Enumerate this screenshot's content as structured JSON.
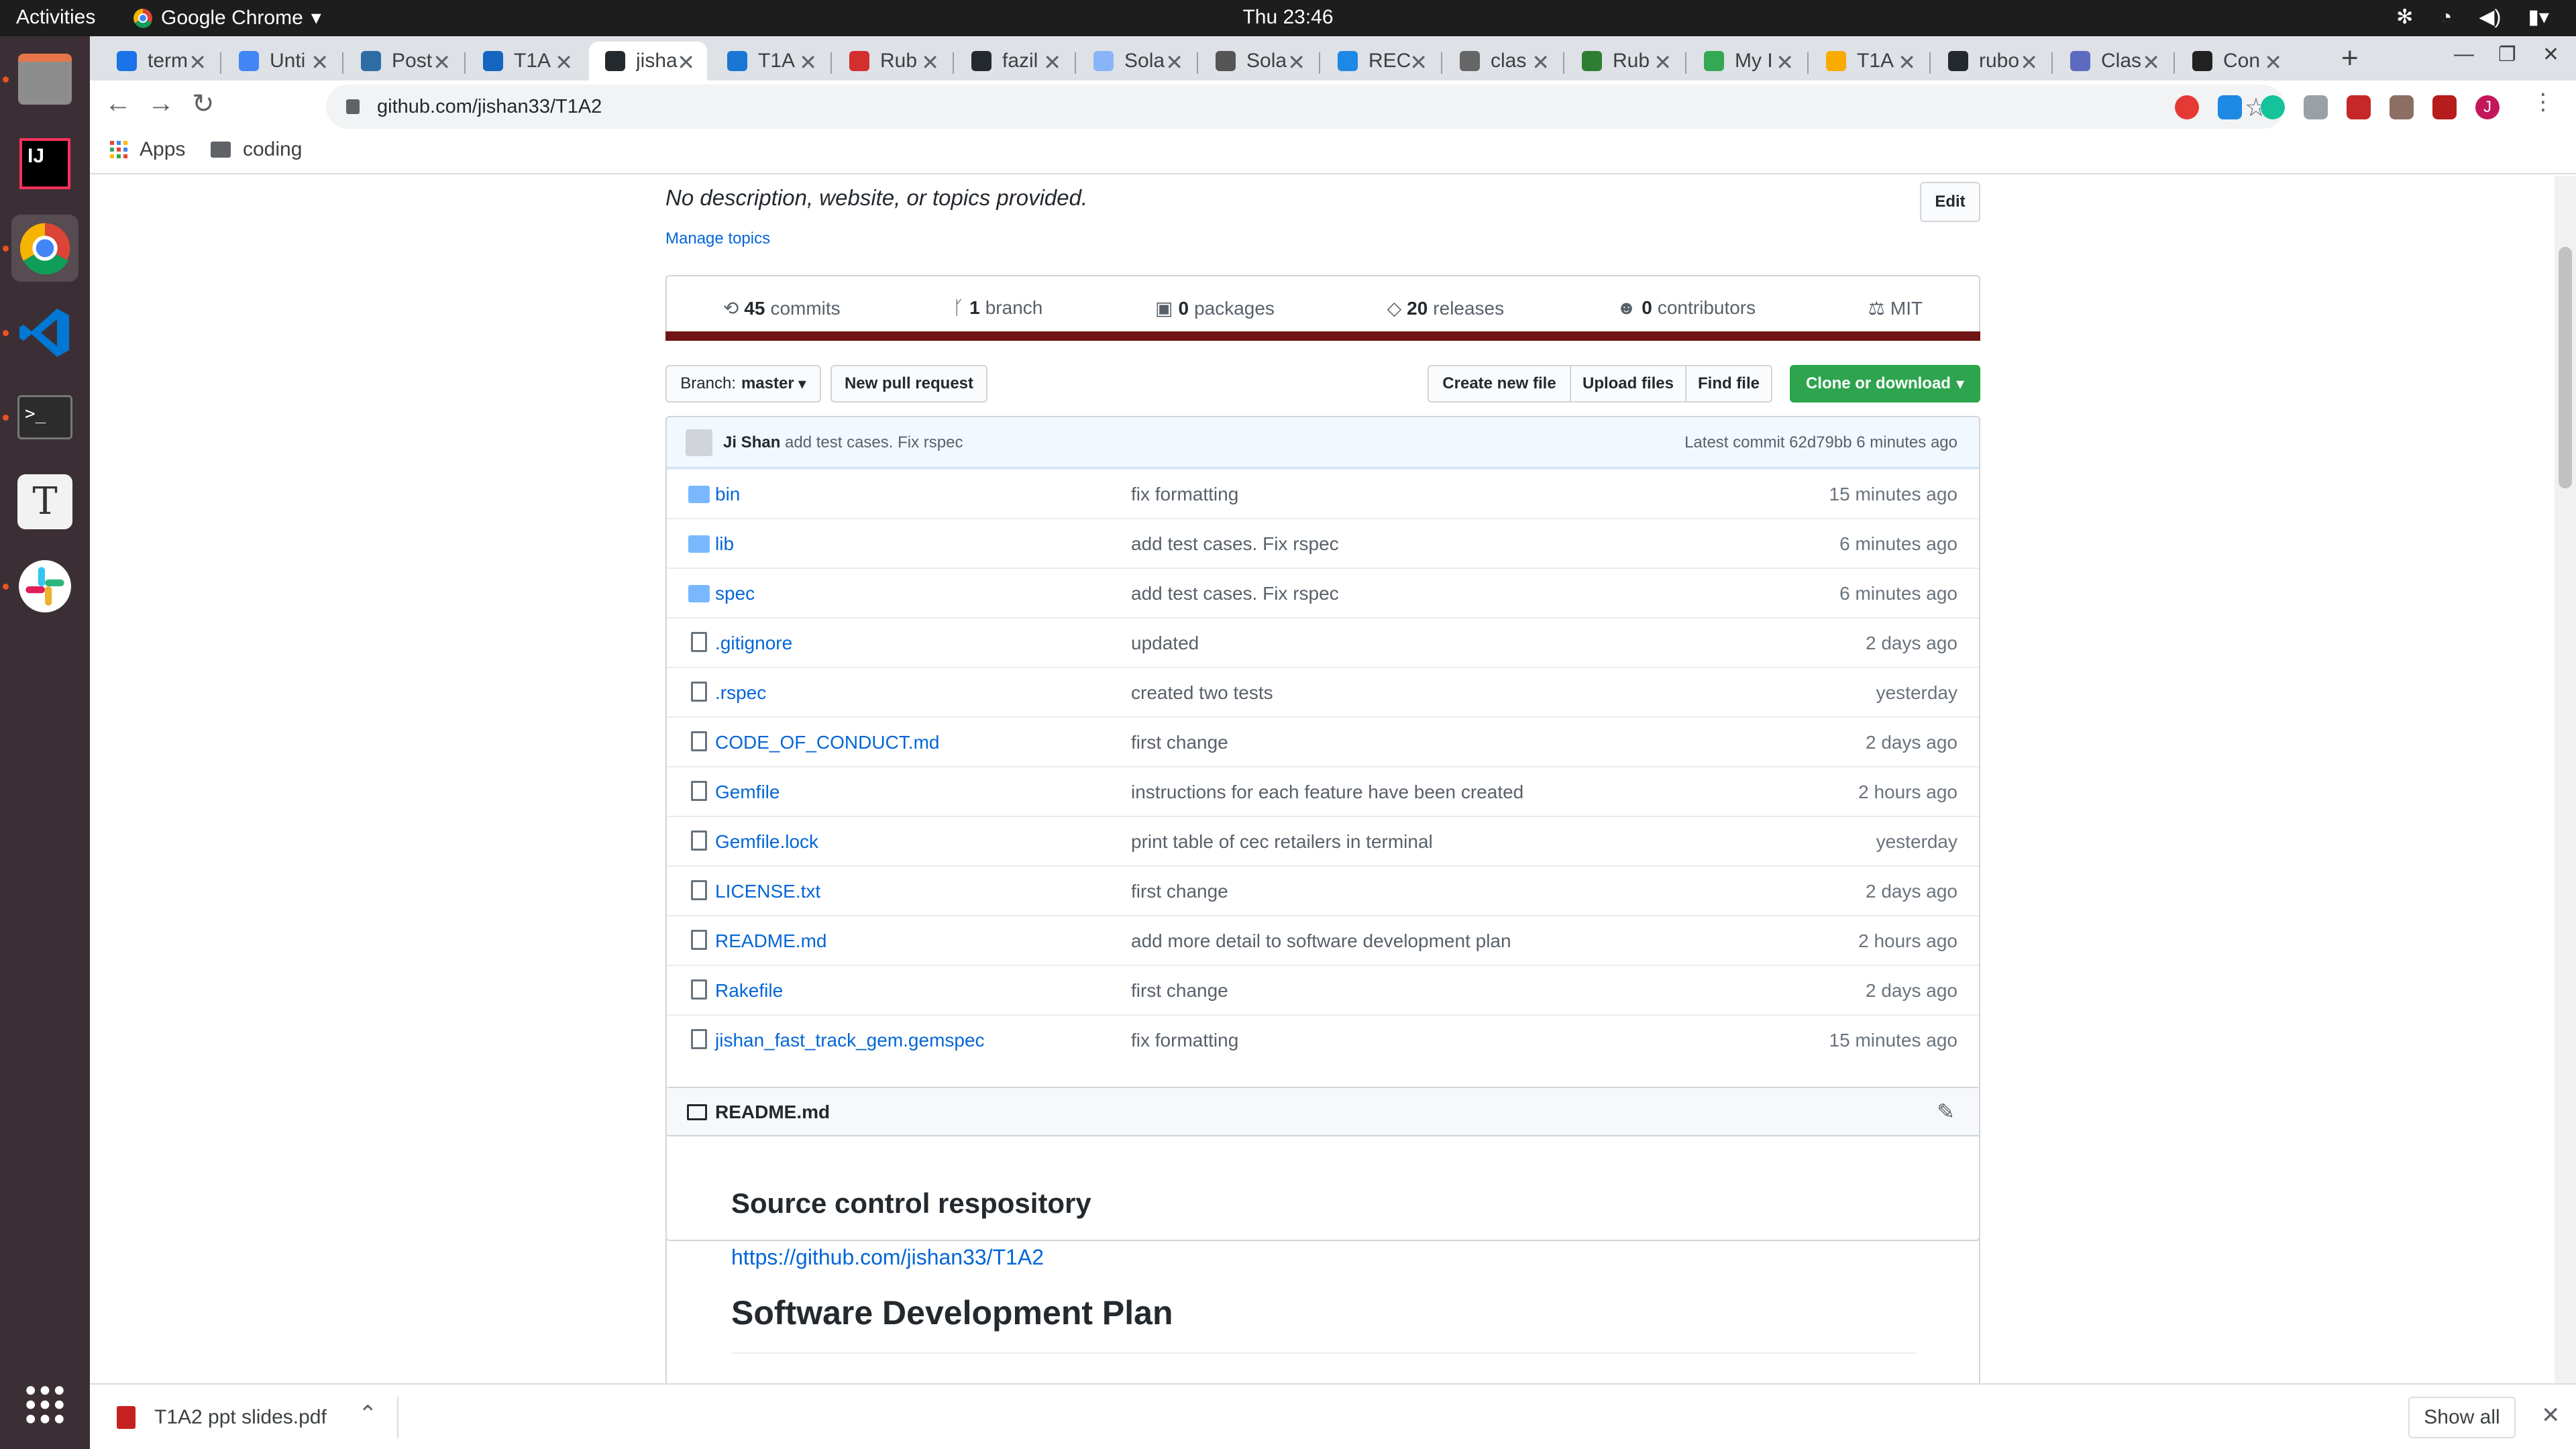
{
  "system": {
    "activities": "Activities",
    "app_name": "Google Chrome",
    "clock": "Thu 23:46"
  },
  "tabs": [
    {
      "title": "term",
      "color": "#1a73e8",
      "active": false
    },
    {
      "title": "Unti",
      "color": "#4285f4",
      "active": false
    },
    {
      "title": "Post",
      "color": "#2e6da4",
      "active": false
    },
    {
      "title": "T1A",
      "color": "#1565c0",
      "active": false
    },
    {
      "title": "jisha",
      "color": "#24292e",
      "active": true
    },
    {
      "title": "T1A",
      "color": "#1976d2",
      "active": false
    },
    {
      "title": "Rub",
      "color": "#d32f2f",
      "active": false
    },
    {
      "title": "fazil",
      "color": "#24292e",
      "active": false
    },
    {
      "title": "Sola",
      "color": "#8ab4f8",
      "active": false
    },
    {
      "title": "Sola",
      "color": "#555555",
      "active": false
    },
    {
      "title": "REC",
      "color": "#1e88e5",
      "active": false
    },
    {
      "title": "clas",
      "color": "#666666",
      "active": false
    },
    {
      "title": "Rub",
      "color": "#2e7d32",
      "active": false
    },
    {
      "title": "My I",
      "color": "#34a853",
      "active": false
    },
    {
      "title": "T1A",
      "color": "#f9ab00",
      "active": false
    },
    {
      "title": "rubo",
      "color": "#24292e",
      "active": false
    },
    {
      "title": "Clas",
      "color": "#5c6bc0",
      "active": false
    },
    {
      "title": "Con",
      "color": "#212121",
      "active": false
    }
  ],
  "browser": {
    "url": "github.com/jishan33/T1A2",
    "bookmarks": {
      "apps": "Apps",
      "coding": "coding"
    },
    "profile_initial": "J"
  },
  "repo": {
    "description": "No description, website, or topics provided.",
    "edit_label": "Edit",
    "manage_topics": "Manage topics",
    "stats": [
      {
        "icon": "commits-icon",
        "count": "45",
        "label": "commits"
      },
      {
        "icon": "branch-icon",
        "count": "1",
        "label": "branch"
      },
      {
        "icon": "package-icon",
        "count": "0",
        "label": "packages"
      },
      {
        "icon": "tag-icon",
        "count": "20",
        "label": "releases"
      },
      {
        "icon": "people-icon",
        "count": "0",
        "label": "contributors"
      },
      {
        "icon": "law-icon",
        "count": "",
        "label": "MIT"
      }
    ],
    "language_color": "#701516",
    "branch_prefix": "Branch:",
    "branch_name": "master",
    "new_pull_request": "New pull request",
    "create_new_file": "Create new file",
    "upload_files": "Upload files",
    "find_file": "Find file",
    "clone_or_download": "Clone or download",
    "latest_commit": {
      "author": "Ji Shan",
      "message": "add test cases. Fix rspec",
      "label": "Latest commit 62d79bb 6 minutes ago"
    },
    "files": [
      {
        "name": "bin",
        "type": "dir",
        "message": "fix formatting",
        "age": "15 minutes ago"
      },
      {
        "name": "lib",
        "type": "dir",
        "message": "add test cases. Fix rspec",
        "age": "6 minutes ago"
      },
      {
        "name": "spec",
        "type": "dir",
        "message": "add test cases. Fix rspec",
        "age": "6 minutes ago"
      },
      {
        "name": ".gitignore",
        "type": "file",
        "message": "updated",
        "age": "2 days ago"
      },
      {
        "name": ".rspec",
        "type": "file",
        "message": "created two tests",
        "age": "yesterday"
      },
      {
        "name": "CODE_OF_CONDUCT.md",
        "type": "file",
        "message": "first change",
        "age": "2 days ago"
      },
      {
        "name": "Gemfile",
        "type": "file",
        "message": "instructions for each feature have been created",
        "age": "2 hours ago"
      },
      {
        "name": "Gemfile.lock",
        "type": "file",
        "message": "print table of cec retailers in terminal",
        "age": "yesterday"
      },
      {
        "name": "LICENSE.txt",
        "type": "file",
        "message": "first change",
        "age": "2 days ago"
      },
      {
        "name": "README.md",
        "type": "file",
        "message": "add more detail to software development plan",
        "age": "2 hours ago"
      },
      {
        "name": "Rakefile",
        "type": "file",
        "message": "first change",
        "age": "2 days ago"
      },
      {
        "name": "jishan_fast_track_gem.gemspec",
        "type": "file",
        "message": "fix formatting",
        "age": "15 minutes ago"
      }
    ],
    "readme": {
      "title": "README.md",
      "h1": "Source control respository",
      "link": "https://github.com/jishan33/T1A2",
      "h2": "Software Development Plan"
    }
  },
  "download": {
    "filename": "T1A2 ppt slides.pdf",
    "show_all": "Show all"
  }
}
